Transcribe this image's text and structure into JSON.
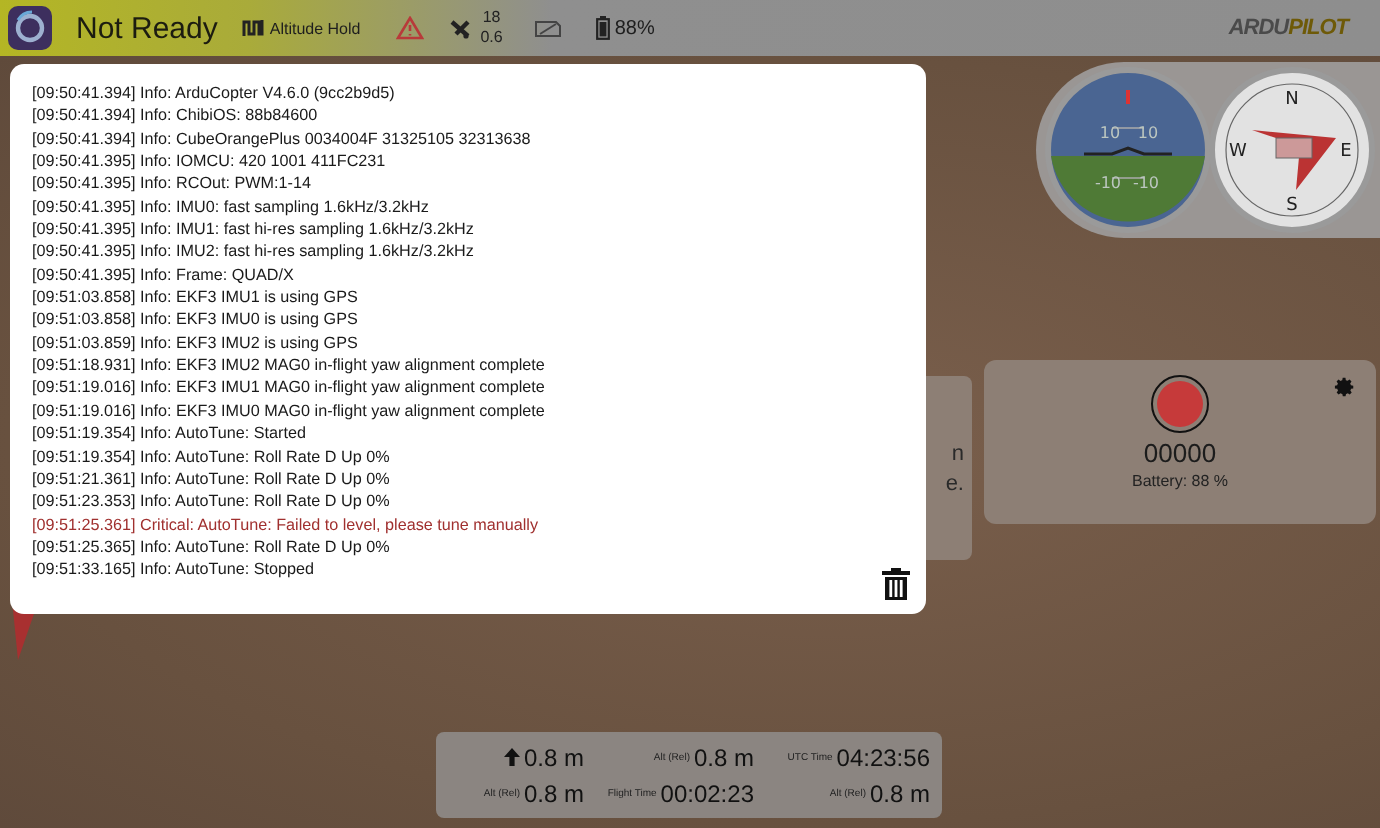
{
  "toolbar": {
    "status": "Not Ready",
    "flight_mode": "Altitude Hold",
    "satellites": {
      "count": "18",
      "hdop": "0.6"
    },
    "battery": "88%",
    "logo": {
      "part_1": "ARDU",
      "part_2": "PILOT"
    }
  },
  "instruments": {
    "attitude_labels": [
      "10",
      "10",
      "-10",
      "-10"
    ],
    "compass_labels": [
      "N",
      "E",
      "S",
      "W"
    ]
  },
  "background_panel": {
    "lines": [
      "n",
      "e."
    ]
  },
  "message_log": {
    "messages": [
      {
        "kind": "info",
        "text": "[09:50:41.394] Info: ArduCopter V4.6.0 (9cc2b9d5)"
      },
      {
        "kind": "info",
        "text": "[09:50:41.394] Info: ChibiOS: 88b84600"
      },
      {
        "kind": "info",
        "text": "[09:50:41.394] Info: CubeOrangePlus 0034004F 31325105 32313638"
      },
      {
        "kind": "info",
        "text": "[09:50:41.395] Info: IOMCU: 420 1001 411FC231"
      },
      {
        "kind": "info",
        "text": "[09:50:41.395] Info: RCOut: PWM:1-14"
      },
      {
        "kind": "info",
        "text": "[09:50:41.395] Info: IMU0: fast sampling 1.6kHz/3.2kHz"
      },
      {
        "kind": "info",
        "text": "[09:50:41.395] Info: IMU1: fast hi-res sampling 1.6kHz/3.2kHz"
      },
      {
        "kind": "info",
        "text": "[09:50:41.395] Info: IMU2: fast hi-res sampling 1.6kHz/3.2kHz"
      },
      {
        "kind": "info",
        "text": "[09:50:41.395] Info: Frame: QUAD/X"
      },
      {
        "kind": "info",
        "text": "[09:51:03.858] Info: EKF3 IMU1 is using GPS"
      },
      {
        "kind": "info",
        "text": "[09:51:03.858] Info: EKF3 IMU0 is using GPS"
      },
      {
        "kind": "info",
        "text": "[09:51:03.859] Info: EKF3 IMU2 is using GPS"
      },
      {
        "kind": "info",
        "text": "[09:51:18.931] Info: EKF3 IMU2 MAG0 in-flight yaw alignment complete"
      },
      {
        "kind": "info",
        "text": "[09:51:19.016] Info: EKF3 IMU1 MAG0 in-flight yaw alignment complete"
      },
      {
        "kind": "info",
        "text": "[09:51:19.016] Info: EKF3 IMU0 MAG0 in-flight yaw alignment complete"
      },
      {
        "kind": "info",
        "text": "[09:51:19.354] Info: AutoTune: Started"
      },
      {
        "kind": "info",
        "text": "[09:51:19.354] Info: AutoTune: Roll Rate D Up 0%"
      },
      {
        "kind": "info",
        "text": "[09:51:21.361] Info: AutoTune: Roll Rate D Up 0%"
      },
      {
        "kind": "info",
        "text": "[09:51:23.353] Info: AutoTune: Roll Rate D Up 0%"
      },
      {
        "kind": "critical",
        "text": "[09:51:25.361] Critical: AutoTune: Failed to level, please tune manually"
      },
      {
        "kind": "info",
        "text": "[09:51:25.365] Info: AutoTune: Roll Rate D Up 0%"
      },
      {
        "kind": "info",
        "text": "[09:51:33.165] Info: AutoTune: Stopped"
      }
    ]
  },
  "video": {
    "counter": "00000",
    "battery": "Battery: 88 %"
  },
  "telemetry": [
    {
      "kind": "icon",
      "value": "0.8 m"
    },
    {
      "kind": "label",
      "label": "Alt (Rel)",
      "value": "0.8 m"
    },
    {
      "kind": "label",
      "label": "UTC Time",
      "value": "04:23:56"
    },
    {
      "kind": "label",
      "label": "Alt (Rel)",
      "value": "0.8 m"
    },
    {
      "kind": "label",
      "label": "Flight Time",
      "value": "00:02:23"
    },
    {
      "kind": "label",
      "label": "Alt (Rel)",
      "value": "0.8 m"
    }
  ]
}
